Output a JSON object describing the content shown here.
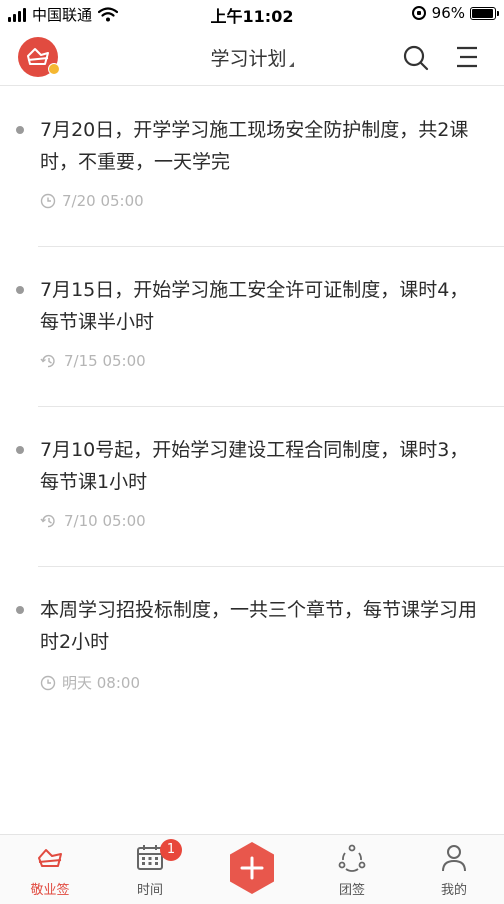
{
  "status_bar": {
    "carrier": "中国联通",
    "time": "上午11:02",
    "battery_percent": "96%",
    "battery_level": 0.96
  },
  "header": {
    "title": "学习计划",
    "logo_icon": "red-seal-logo-icon",
    "search_icon": "search-icon",
    "menu_icon": "menu-icon"
  },
  "plans": [
    {
      "text": "7月20日，开学学习施工现场安全防护制度，共2课时，不重要，一天学完",
      "time": "7/20 05:00",
      "icon": "clock-icon"
    },
    {
      "text": "7月15日，开始学习施工安全许可证制度，课时4，每节课半小时",
      "time": "7/15 05:00",
      "icon": "alarm-repeat-icon"
    },
    {
      "text": "7月10号起，开始学习建设工程合同制度，课时3，每节课1小时",
      "time": "7/10 05:00",
      "icon": "alarm-repeat-icon"
    },
    {
      "text": "本周学习招投标制度，一共三个章节，每节课学习用时2小时",
      "time": "明天 08:00",
      "icon": "clock-icon"
    }
  ],
  "tabbar": {
    "items": [
      {
        "label": "敬业签",
        "icon": "seal-icon",
        "active": true
      },
      {
        "label": "时间",
        "icon": "calendar-icon",
        "badge": "1"
      },
      {
        "label": "",
        "icon": "plus-icon"
      },
      {
        "label": "团签",
        "icon": "team-icon"
      },
      {
        "label": "我的",
        "icon": "person-icon"
      }
    ]
  },
  "colors": {
    "accent": "#e14b40",
    "badge": "#e8473b",
    "meta_text": "#b5b5b5"
  }
}
